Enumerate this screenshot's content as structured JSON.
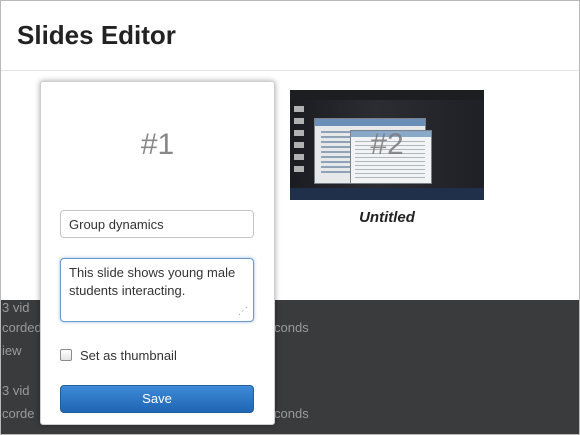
{
  "header": {
    "title": "Slides Editor"
  },
  "slides": [
    {
      "number": "#1",
      "title_value": "Group dynamics",
      "description_value": "This slide shows young male students interacting.",
      "thumbnail_label": "Set as thumbnail",
      "thumbnail_checked": false,
      "save_label": "Save"
    },
    {
      "number": "#2",
      "caption": "Untitled"
    }
  ],
  "background": {
    "row1_count": "3 vid",
    "row1_recorded": "corded",
    "row1_seconds": "conds",
    "row1_view": "iew",
    "row2_count": "3 vid",
    "row2_recorded": "corde",
    "row2_seconds": "conds"
  },
  "icons": {
    "resize_grip": "resize-grip-icon"
  }
}
